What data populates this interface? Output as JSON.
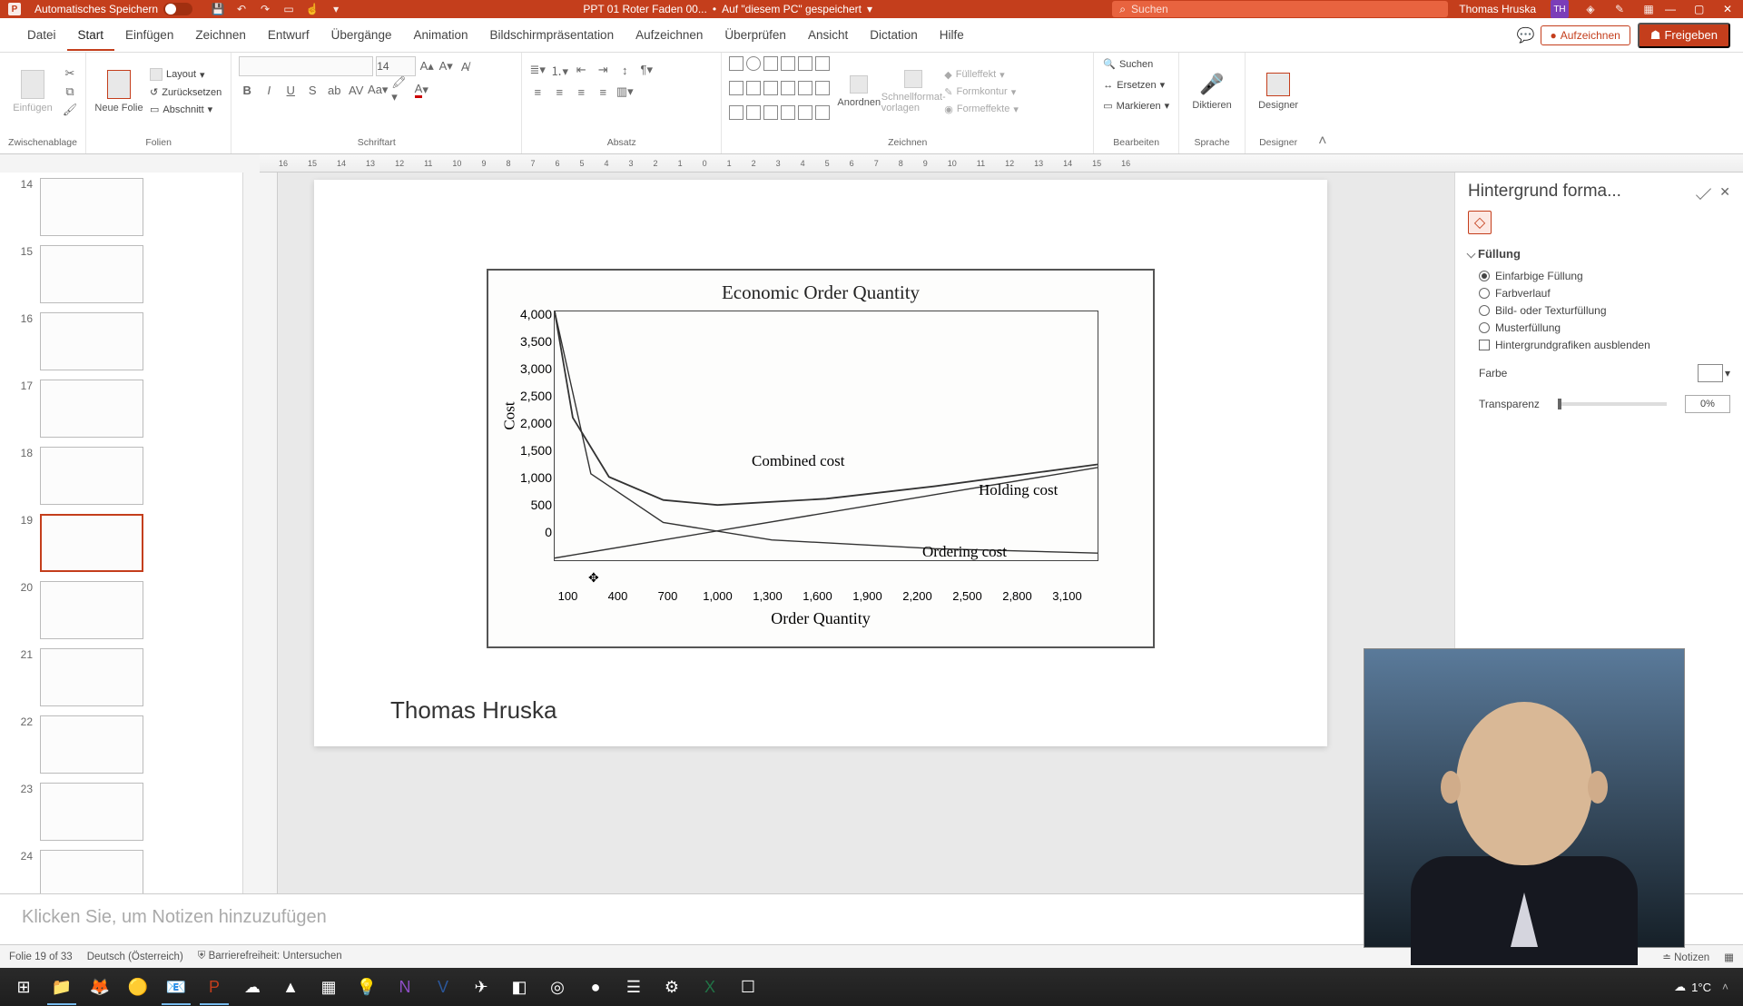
{
  "titlebar": {
    "autosave_label": "Automatisches Speichern",
    "filename": "PPT 01 Roter Faden 00...",
    "saved_hint": "Auf \"diesem PC\" gespeichert",
    "search_placeholder": "Suchen",
    "user_name": "Thomas Hruska",
    "user_initials": "TH"
  },
  "tabs": {
    "items": [
      "Datei",
      "Start",
      "Einfügen",
      "Zeichnen",
      "Entwurf",
      "Übergänge",
      "Animation",
      "Bildschirmpräsentation",
      "Aufzeichnen",
      "Überprüfen",
      "Ansicht",
      "Dictation",
      "Hilfe"
    ],
    "active_index": 1,
    "record_label": "Aufzeichnen",
    "share_label": "Freigeben"
  },
  "ribbon": {
    "clipboard": {
      "paste": "Einfügen",
      "group": "Zwischenablage"
    },
    "slides": {
      "new": "Neue Folie",
      "layout": "Layout",
      "reset": "Zurücksetzen",
      "section": "Abschnitt",
      "group": "Folien"
    },
    "font": {
      "name_ph": "",
      "size": "14",
      "group": "Schriftart"
    },
    "paragraph": {
      "group": "Absatz"
    },
    "drawing": {
      "arrange": "Anordnen",
      "quickstyles": "Schnellformat-vorlagen",
      "fill": "Fülleffekt",
      "outline": "Formkontur",
      "effects": "Formeffekte",
      "group": "Zeichnen"
    },
    "editing": {
      "find": "Suchen",
      "replace": "Ersetzen",
      "select": "Markieren",
      "group": "Bearbeiten"
    },
    "voice": {
      "dictate": "Diktieren",
      "group": "Sprache"
    },
    "designer": {
      "btn": "Designer",
      "group": "Designer"
    }
  },
  "ruler": {
    "marks": [
      "16",
      "15",
      "14",
      "13",
      "12",
      "11",
      "10",
      "9",
      "8",
      "7",
      "6",
      "5",
      "4",
      "3",
      "2",
      "1",
      "0",
      "1",
      "2",
      "3",
      "4",
      "5",
      "6",
      "7",
      "8",
      "9",
      "10",
      "11",
      "12",
      "13",
      "14",
      "15",
      "16"
    ]
  },
  "thumbs": {
    "items": [
      {
        "n": 14
      },
      {
        "n": 15
      },
      {
        "n": 16
      },
      {
        "n": 17
      },
      {
        "n": 18
      },
      {
        "n": 19,
        "active": true
      },
      {
        "n": 20
      },
      {
        "n": 21
      },
      {
        "n": 22
      },
      {
        "n": 23
      },
      {
        "n": 24
      }
    ]
  },
  "slide": {
    "author": "Thomas Hruska"
  },
  "chart_data": {
    "type": "line",
    "title": "Economic Order Quantity",
    "xlabel": "Order Quantity",
    "ylabel": "Cost",
    "xlim": [
      100,
      3100
    ],
    "ylim": [
      0,
      4000
    ],
    "x_ticks": [
      "100",
      "400",
      "700",
      "1,000",
      "1,300",
      "1,600",
      "1,900",
      "2,200",
      "2,500",
      "2,800",
      "3,100"
    ],
    "y_ticks": [
      "4,000",
      "3,500",
      "3,000",
      "2,500",
      "2,000",
      "1,500",
      "1,000",
      "500",
      "0"
    ],
    "series": [
      {
        "name": "Combined cost",
        "x": [
          100,
          200,
          400,
          700,
          1000,
          1600,
          2200,
          3100
        ],
        "values": [
          4000,
          2300,
          1350,
          980,
          900,
          1000,
          1200,
          1550
        ]
      },
      {
        "name": "Holding cost",
        "x": [
          100,
          3100
        ],
        "values": [
          50,
          1500
        ]
      },
      {
        "name": "Ordering cost",
        "x": [
          100,
          300,
          700,
          1300,
          2200,
          3100
        ],
        "values": [
          4000,
          1400,
          620,
          340,
          200,
          130
        ]
      }
    ],
    "annotations": [
      {
        "text": "Combined cost",
        "x": 1300,
        "y": 2100
      },
      {
        "text": "Holding cost",
        "x": 2500,
        "y": 1600
      },
      {
        "text": "Ordering cost",
        "x": 2300,
        "y": 550
      }
    ]
  },
  "notes": {
    "placeholder": "Klicken Sie, um Notizen hinzuzufügen"
  },
  "format_pane": {
    "title": "Hintergrund forma...",
    "section": "Füllung",
    "opt_solid": "Einfarbige Füllung",
    "opt_gradient": "Farbverlauf",
    "opt_picture": "Bild- oder Texturfüllung",
    "opt_pattern": "Musterfüllung",
    "opt_hide": "Hintergrundgrafiken ausblenden",
    "color_label": "Farbe",
    "transparency_label": "Transparenz",
    "transparency_value": "0%"
  },
  "statusbar": {
    "slide_of": "Folie 19 of 33",
    "lang": "Deutsch (Österreich)",
    "a11y": "Barrierefreiheit: Untersuchen",
    "notes": "Notizen"
  },
  "taskbar": {
    "weather_temp": "1°C"
  }
}
